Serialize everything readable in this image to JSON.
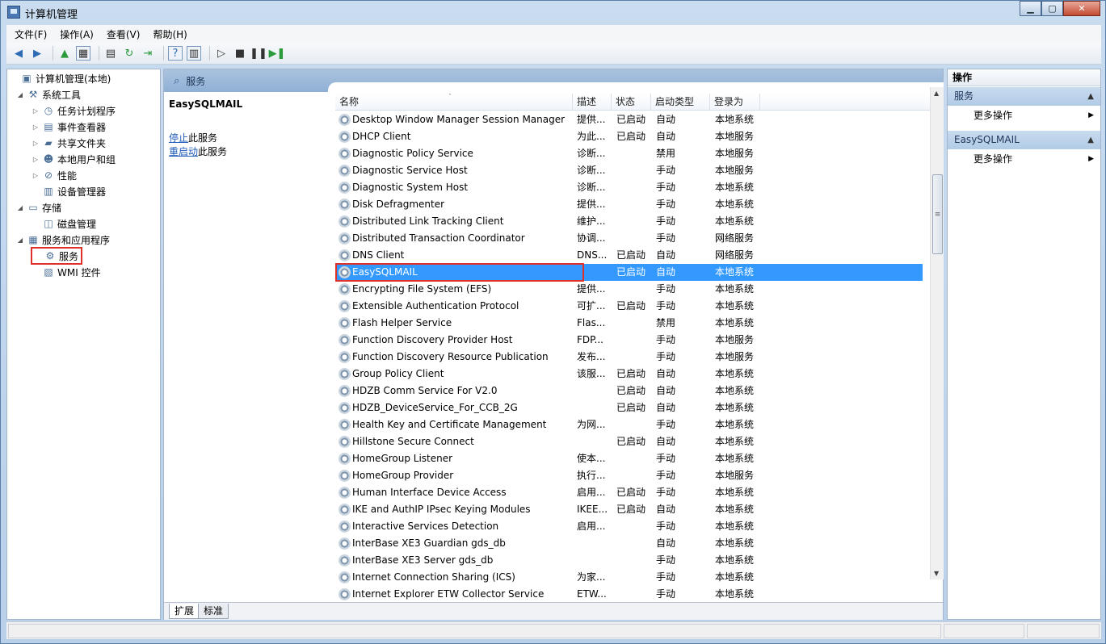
{
  "window": {
    "title": "计算机管理"
  },
  "menu": [
    "文件(F)",
    "操作(A)",
    "查看(V)",
    "帮助(H)"
  ],
  "tree": [
    {
      "label": "计算机管理(本地)",
      "level": 0,
      "arrow": "",
      "icon": "computer-icon"
    },
    {
      "label": "系统工具",
      "level": 1,
      "arrow": "◢",
      "icon": "tools-icon"
    },
    {
      "label": "任务计划程序",
      "level": 2,
      "arrow": "▷",
      "icon": "clock-icon"
    },
    {
      "label": "事件查看器",
      "level": 2,
      "arrow": "▷",
      "icon": "event-viewer-icon"
    },
    {
      "label": "共享文件夹",
      "level": 2,
      "arrow": "▷",
      "icon": "shared-folder-icon"
    },
    {
      "label": "本地用户和组",
      "level": 2,
      "arrow": "▷",
      "icon": "users-icon"
    },
    {
      "label": "性能",
      "level": 2,
      "arrow": "▷",
      "icon": "performance-icon"
    },
    {
      "label": "设备管理器",
      "level": 2,
      "arrow": "",
      "icon": "device-manager-icon"
    },
    {
      "label": "存储",
      "level": 1,
      "arrow": "◢",
      "icon": "storage-icon"
    },
    {
      "label": "磁盘管理",
      "level": 2,
      "arrow": "",
      "icon": "disk-icon"
    },
    {
      "label": "服务和应用程序",
      "level": 1,
      "arrow": "◢",
      "icon": "services-apps-icon"
    },
    {
      "label": "服务",
      "level": 2,
      "arrow": "",
      "icon": "gear-icon",
      "selected": true
    },
    {
      "label": "WMI 控件",
      "level": 2,
      "arrow": "",
      "icon": "wmi-icon"
    }
  ],
  "middle": {
    "header": "服务",
    "selected_service": "EasySQLMAIL",
    "stop_link": "停止",
    "stop_suffix": "此服务",
    "restart_link": "重启动",
    "restart_suffix": "此服务",
    "columns": [
      "名称",
      "描述",
      "状态",
      "启动类型",
      "登录为"
    ],
    "rows": [
      [
        "Desktop Window Manager Session Manager",
        "提供...",
        "已启动",
        "自动",
        "本地系统"
      ],
      [
        "DHCP Client",
        "为此...",
        "已启动",
        "自动",
        "本地服务"
      ],
      [
        "Diagnostic Policy Service",
        "诊断...",
        "",
        "禁用",
        "本地服务"
      ],
      [
        "Diagnostic Service Host",
        "诊断...",
        "",
        "手动",
        "本地服务"
      ],
      [
        "Diagnostic System Host",
        "诊断...",
        "",
        "手动",
        "本地系统"
      ],
      [
        "Disk Defragmenter",
        "提供...",
        "",
        "手动",
        "本地系统"
      ],
      [
        "Distributed Link Tracking Client",
        "维护...",
        "",
        "手动",
        "本地系统"
      ],
      [
        "Distributed Transaction Coordinator",
        "协调...",
        "",
        "手动",
        "网络服务"
      ],
      [
        "DNS Client",
        "DNS...",
        "已启动",
        "自动",
        "网络服务"
      ],
      [
        "EasySQLMAIL",
        "",
        "已启动",
        "自动",
        "本地系统"
      ],
      [
        "Encrypting File System (EFS)",
        "提供...",
        "",
        "手动",
        "本地系统"
      ],
      [
        "Extensible Authentication Protocol",
        "可扩...",
        "已启动",
        "手动",
        "本地系统"
      ],
      [
        "Flash Helper Service",
        "Flas...",
        "",
        "禁用",
        "本地系统"
      ],
      [
        "Function Discovery Provider Host",
        "FDP...",
        "",
        "手动",
        "本地服务"
      ],
      [
        "Function Discovery Resource Publication",
        "发布...",
        "",
        "手动",
        "本地服务"
      ],
      [
        "Group Policy Client",
        "该服...",
        "已启动",
        "自动",
        "本地系统"
      ],
      [
        "HDZB Comm Service For V2.0",
        "",
        "已启动",
        "自动",
        "本地系统"
      ],
      [
        "HDZB_DeviceService_For_CCB_2G",
        "",
        "已启动",
        "自动",
        "本地系统"
      ],
      [
        "Health Key and Certificate Management",
        "为网...",
        "",
        "手动",
        "本地系统"
      ],
      [
        "Hillstone Secure Connect",
        "",
        "已启动",
        "自动",
        "本地系统"
      ],
      [
        "HomeGroup Listener",
        "使本...",
        "",
        "手动",
        "本地系统"
      ],
      [
        "HomeGroup Provider",
        "执行...",
        "",
        "手动",
        "本地服务"
      ],
      [
        "Human Interface Device Access",
        "启用...",
        "已启动",
        "手动",
        "本地系统"
      ],
      [
        "IKE and AuthIP IPsec Keying Modules",
        "IKEE...",
        "已启动",
        "自动",
        "本地系统"
      ],
      [
        "Interactive Services Detection",
        "启用...",
        "",
        "手动",
        "本地系统"
      ],
      [
        "InterBase XE3 Guardian gds_db",
        "",
        "",
        "自动",
        "本地系统"
      ],
      [
        "InterBase XE3 Server gds_db",
        "",
        "",
        "手动",
        "本地系统"
      ],
      [
        "Internet Connection Sharing (ICS)",
        "为家...",
        "",
        "手动",
        "本地系统"
      ],
      [
        "Internet Explorer ETW Collector Service",
        "ETW...",
        "",
        "手动",
        "本地系统"
      ]
    ],
    "tabs": [
      "扩展",
      "标准"
    ]
  },
  "actions": {
    "title": "操作",
    "sections": [
      {
        "label": "服务",
        "item": "更多操作"
      },
      {
        "label": "EasySQLMAIL",
        "item": "更多操作"
      }
    ]
  },
  "colors": {
    "selection": "#3399ff",
    "highlight_box": "#e0302a",
    "link": "#1e5bb8"
  }
}
